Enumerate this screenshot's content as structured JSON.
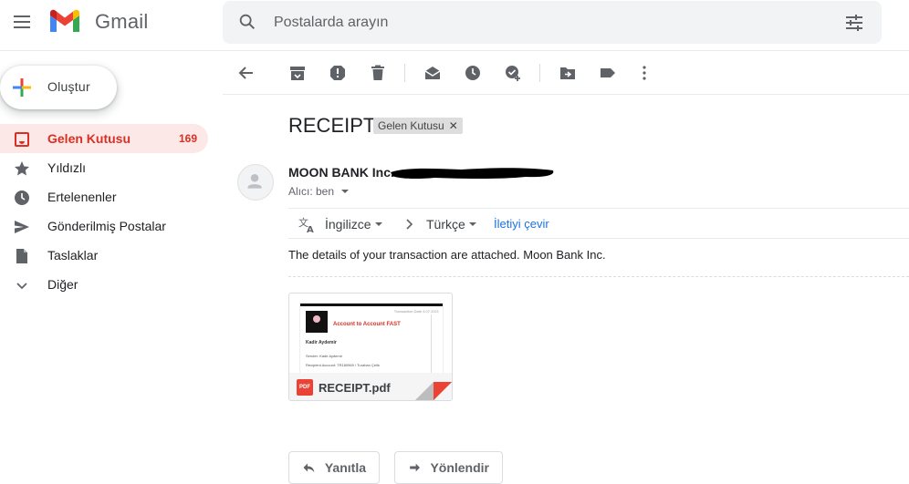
{
  "app": {
    "name": "Gmail"
  },
  "search": {
    "placeholder": "Postalarda arayın"
  },
  "compose": {
    "label": "Oluştur"
  },
  "sidebar": {
    "items": [
      {
        "label": "Gelen Kutusu",
        "count": "169",
        "icon": "inbox-icon"
      },
      {
        "label": "Yıldızlı",
        "icon": "star-icon"
      },
      {
        "label": "Ertelenenler",
        "icon": "clock-icon"
      },
      {
        "label": "Gönderilmiş Postalar",
        "icon": "send-icon"
      },
      {
        "label": "Taslaklar",
        "icon": "draft-icon"
      },
      {
        "label": "Diğer",
        "icon": "chevron-down-icon"
      }
    ]
  },
  "toolbar": {
    "icons": [
      "back-arrow-icon",
      "archive-icon",
      "report-spam-icon",
      "delete-icon",
      "mark-unread-icon",
      "snooze-icon",
      "add-to-tasks-icon",
      "move-to-icon",
      "label-icon",
      "more-vert-icon"
    ]
  },
  "message": {
    "subject": "RECEIPT",
    "label_chip": "Gelen Kutusu",
    "sender": "MOON BANK Inc.",
    "to_line": "Alıcı: ben",
    "body": "The details of your transaction are attached. Moon Bank Inc."
  },
  "translate": {
    "source_lang": "İngilizce",
    "target_lang": "Türkçe",
    "link": "İletiyi çevir"
  },
  "attachment": {
    "filename": "RECEIPT.pdf",
    "file_type": "PDF",
    "thumb_title": "Account to Account  FAST",
    "thumb_date": "Transaction Date  4.07.2021",
    "thumb_name": "Kadir Aydemir",
    "thumb_line1": "Sender: Kadir Aydemir",
    "thumb_line2": "Recipient Account: TR180969 / Turahan Çelik"
  },
  "actions": {
    "reply": "Yanıtla",
    "forward": "Yönlendir"
  },
  "colors": {
    "accent_red": "#d93025",
    "active_bg": "#fce8e6",
    "link_blue": "#1a73e8"
  }
}
